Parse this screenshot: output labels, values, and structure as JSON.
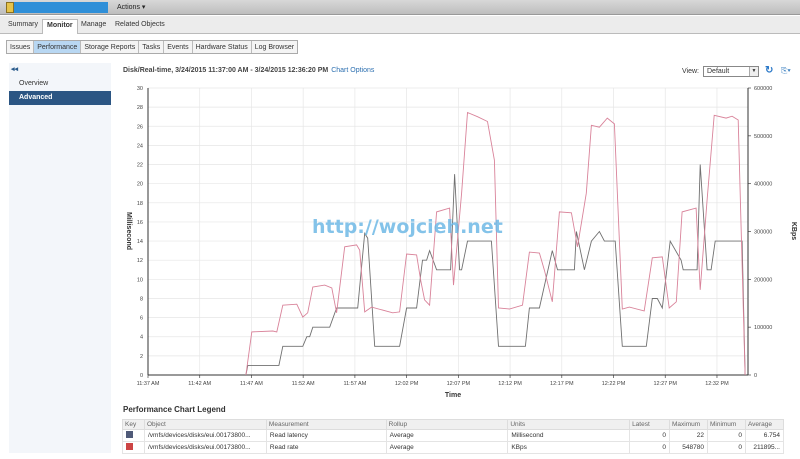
{
  "header": {
    "actions_label": "Actions ▾"
  },
  "tabs": [
    {
      "label": "Summary"
    },
    {
      "label": "Monitor",
      "active": true
    },
    {
      "label": "Manage"
    },
    {
      "label": "Related Objects"
    }
  ],
  "subtabs": [
    {
      "label": "Issues"
    },
    {
      "label": "Performance",
      "active": true
    },
    {
      "label": "Storage Reports"
    },
    {
      "label": "Tasks"
    },
    {
      "label": "Events"
    },
    {
      "label": "Hardware Status"
    },
    {
      "label": "Log Browser"
    }
  ],
  "sidebar": {
    "collapse": "◂◂",
    "items": [
      {
        "label": "Overview"
      },
      {
        "label": "Advanced",
        "selected": true
      }
    ]
  },
  "chart_header": {
    "title": "Disk/Real-time, 3/24/2015 11:37:00 AM - 3/24/2015 12:36:20 PM",
    "options_link": "Chart Options",
    "view_label": "View:",
    "view_value": "Default"
  },
  "watermark": "http://wojcieh.net",
  "chart_data": {
    "type": "line",
    "xlabel": "Time",
    "ylabel": "Millisecond",
    "y2label": "KBps",
    "xlim": [
      "11:37:00",
      "12:35:00"
    ],
    "ylim": [
      0,
      30
    ],
    "y2lim": [
      0,
      600000
    ],
    "xticks": [
      "11:37 AM",
      "11:42 AM",
      "11:47 AM",
      "11:52 AM",
      "11:57 AM",
      "12:02 PM",
      "12:07 PM",
      "12:12 PM",
      "12:17 PM",
      "12:22 PM",
      "12:27 PM",
      "12:32 PM"
    ],
    "yticks": [
      0,
      2,
      4,
      6,
      8,
      10,
      12,
      14,
      16,
      18,
      20,
      22,
      24,
      26,
      28,
      30
    ],
    "y2ticks": [
      0,
      100000,
      200000,
      300000,
      400000,
      500000,
      600000
    ],
    "grid": true,
    "series": [
      {
        "name": "Read latency",
        "axis": "left",
        "color": "#707070",
        "points": [
          [
            "11:46:28",
            0
          ],
          [
            "11:46:39",
            1
          ],
          [
            "11:49:39",
            1
          ],
          [
            "11:50:02",
            3
          ],
          [
            "11:51:58",
            3
          ],
          [
            "11:52:21",
            4
          ],
          [
            "11:52:38",
            4
          ],
          [
            "11:52:56",
            5
          ],
          [
            "11:54:34",
            5
          ],
          [
            "11:55:14",
            7
          ],
          [
            "11:57:16",
            7
          ],
          [
            "11:57:57",
            14.8
          ],
          [
            "11:58:14",
            14.3
          ],
          [
            "11:58:55",
            3
          ],
          [
            "12:01:19",
            3
          ],
          [
            "12:02:00",
            7
          ],
          [
            "12:02:58",
            7
          ],
          [
            "12:03:32",
            12
          ],
          [
            "12:03:56",
            12
          ],
          [
            "12:04:13",
            13
          ],
          [
            "12:04:54",
            11
          ],
          [
            "12:06:15",
            11
          ],
          [
            "12:06:38",
            21
          ],
          [
            "12:07:07",
            11
          ],
          [
            "12:07:19",
            11
          ],
          [
            "12:07:53",
            14
          ],
          [
            "12:10:12",
            14
          ],
          [
            "12:10:53",
            3
          ],
          [
            "12:13:29",
            3
          ],
          [
            "12:13:52",
            7
          ],
          [
            "12:14:50",
            7
          ],
          [
            "12:16:05",
            13
          ],
          [
            "12:16:35",
            11
          ],
          [
            "12:18:13",
            11
          ],
          [
            "12:18:25",
            15
          ],
          [
            "12:19:11",
            11
          ],
          [
            "12:19:52",
            14
          ],
          [
            "12:20:38",
            15
          ],
          [
            "12:21:07",
            14
          ],
          [
            "12:22:10",
            14
          ],
          [
            "12:22:51",
            3
          ],
          [
            "12:25:10",
            3
          ],
          [
            "12:25:45",
            8
          ],
          [
            "12:26:14",
            8
          ],
          [
            "12:26:43",
            7
          ],
          [
            "12:27:29",
            14
          ],
          [
            "12:28:32",
            12
          ],
          [
            "12:28:44",
            11
          ],
          [
            "12:30:05",
            11
          ],
          [
            "12:30:23",
            22
          ],
          [
            "12:31:03",
            11
          ],
          [
            "12:31:26",
            11
          ],
          [
            "12:31:50",
            14
          ],
          [
            "12:34:26",
            14
          ],
          [
            "12:34:43",
            0
          ]
        ]
      },
      {
        "name": "Read rate",
        "axis": "right",
        "color": "#d9839a",
        "points": [
          [
            "11:46:28",
            0
          ],
          [
            "11:47:02",
            90000
          ],
          [
            "11:49:04",
            92000
          ],
          [
            "11:49:27",
            90000
          ],
          [
            "11:50:02",
            146000
          ],
          [
            "11:51:23",
            148000
          ],
          [
            "11:51:58",
            121000
          ],
          [
            "11:52:26",
            130000
          ],
          [
            "11:52:56",
            184000
          ],
          [
            "11:54:05",
            188000
          ],
          [
            "11:54:46",
            182000
          ],
          [
            "11:55:14",
            130000
          ],
          [
            "11:56:01",
            268000
          ],
          [
            "11:57:10",
            272000
          ],
          [
            "11:57:28",
            261000
          ],
          [
            "11:57:57",
            132000
          ],
          [
            "11:58:37",
            142000
          ],
          [
            "12:00:39",
            130000
          ],
          [
            "12:01:19",
            132000
          ],
          [
            "12:02:00",
            253000
          ],
          [
            "12:02:58",
            251000
          ],
          [
            "12:03:21",
            199000
          ],
          [
            "12:03:44",
            157000
          ],
          [
            "12:04:13",
            146000
          ],
          [
            "12:04:54",
            341000
          ],
          [
            "12:06:09",
            349000
          ],
          [
            "12:06:32",
            188000
          ],
          [
            "12:07:19",
            380000
          ],
          [
            "12:07:53",
            548780
          ],
          [
            "12:08:51",
            540000
          ],
          [
            "12:09:49",
            530000
          ],
          [
            "12:10:29",
            449000
          ],
          [
            "12:10:53",
            140000
          ],
          [
            "12:11:56",
            138000
          ],
          [
            "12:13:12",
            146000
          ],
          [
            "12:13:52",
            257000
          ],
          [
            "12:14:50",
            255000
          ],
          [
            "12:15:19",
            219000
          ],
          [
            "12:16:05",
            153000
          ],
          [
            "12:16:46",
            341000
          ],
          [
            "12:17:56",
            339000
          ],
          [
            "12:18:31",
            268000
          ],
          [
            "12:19:22",
            380000
          ],
          [
            "12:19:52",
            522000
          ],
          [
            "12:20:38",
            518000
          ],
          [
            "12:21:24",
            537000
          ],
          [
            "12:22:05",
            525000
          ],
          [
            "12:22:51",
            138000
          ],
          [
            "12:23:32",
            142000
          ],
          [
            "12:24:58",
            134000
          ],
          [
            "12:25:45",
            245000
          ],
          [
            "12:26:43",
            247000
          ],
          [
            "12:27:23",
            140000
          ],
          [
            "12:28:04",
            153000
          ],
          [
            "12:28:38",
            341000
          ],
          [
            "12:29:59",
            349000
          ],
          [
            "12:30:23",
            178000
          ],
          [
            "12:31:03",
            366000
          ],
          [
            "12:31:44",
            543000
          ],
          [
            "12:32:53",
            537000
          ],
          [
            "12:33:28",
            541000
          ],
          [
            "12:34:03",
            533000
          ],
          [
            "12:34:43",
            0
          ]
        ]
      }
    ]
  },
  "legend": {
    "title": "Performance Chart Legend",
    "columns": [
      "Key",
      "Object",
      "Measurement",
      "Rollup",
      "Units",
      "Latest",
      "Maximum",
      "Minimum",
      "Average"
    ],
    "rows": [
      {
        "color": "#4f5a78",
        "object": "/vmfs/devices/disks/eui.00173800...",
        "measurement": "Read latency",
        "rollup": "Average",
        "units": "Millisecond",
        "latest": "0",
        "maximum": "22",
        "minimum": "0",
        "average": "6.754"
      },
      {
        "color": "#cc4444",
        "object": "/vmfs/devices/disks/eui.00173800...",
        "measurement": "Read rate",
        "rollup": "Average",
        "units": "KBps",
        "latest": "0",
        "maximum": "548780",
        "minimum": "0",
        "average": "211895..."
      }
    ]
  }
}
